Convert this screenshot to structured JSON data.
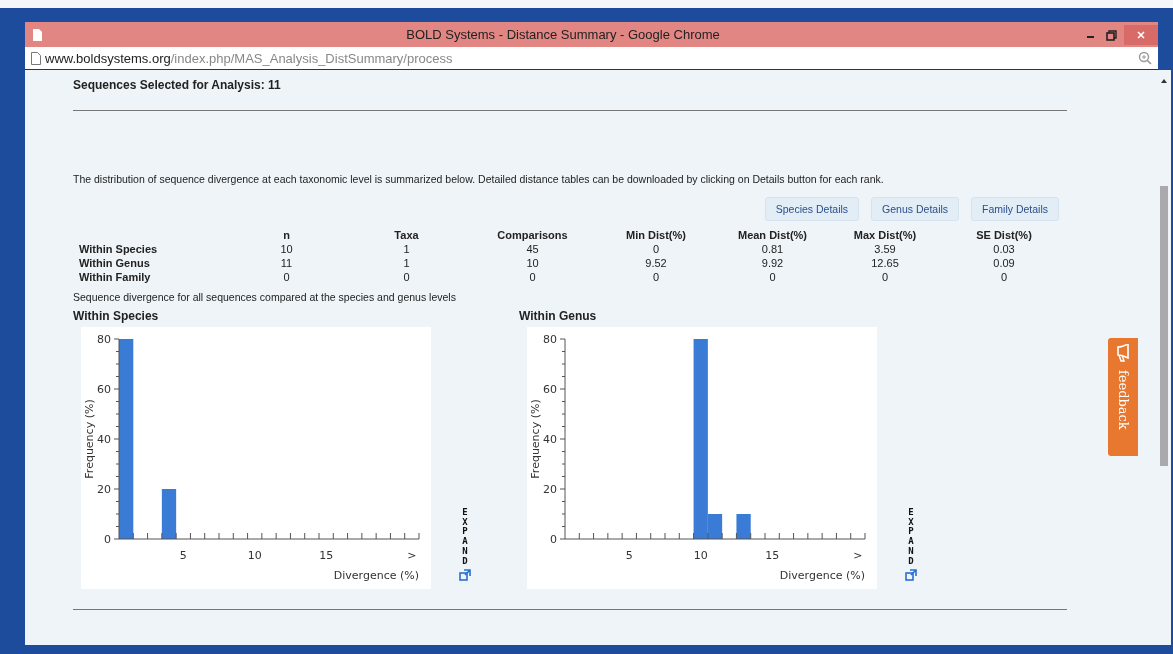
{
  "window": {
    "title": "BOLD Systems - Distance Summary - Google Chrome"
  },
  "address_bar": {
    "host": "www.boldsystems.org",
    "path": "/index.php/MAS_Analysis_DistSummary/process"
  },
  "heading": "Sequences Selected for Analysis: 11",
  "description": "The distribution of sequence divergence at each taxonomic level is summarized below. Detailed distance tables can be downloaded by clicking on Details button for each rank.",
  "buttons": [
    "Species Details",
    "Genus Details",
    "Family Details"
  ],
  "table": {
    "columns": [
      "",
      "n",
      "Taxa",
      "Comparisons",
      "Min Dist(%)",
      "Mean Dist(%)",
      "Max Dist(%)",
      "SE Dist(%)"
    ],
    "rows": [
      [
        "Within Species",
        "10",
        "1",
        "45",
        "0",
        "0.81",
        "3.59",
        "0.03"
      ],
      [
        "Within Genus",
        "11",
        "1",
        "10",
        "9.52",
        "9.92",
        "12.65",
        "0.09"
      ],
      [
        "Within Family",
        "0",
        "0",
        "0",
        "0",
        "0",
        "0",
        "0"
      ]
    ]
  },
  "charts_caption": "Sequence divergence for all sequences compared at the species and genus levels",
  "charts": [
    {
      "expand_label": "EXPAND",
      "chart_data": {
        "type": "bar",
        "title": "Within Species",
        "xlabel": "Divergence (%)",
        "ylabel": "Frequency (%)",
        "x": [
          1,
          2,
          3,
          4,
          5,
          6,
          7,
          8,
          9,
          10,
          11,
          12,
          13,
          14,
          15,
          16,
          17,
          18,
          19,
          20,
          21
        ],
        "series": [
          {
            "color": "#3a7bd5",
            "values": [
              80,
              0,
              0,
              20,
              0,
              0,
              0,
              0,
              0,
              0,
              0,
              0,
              0,
              0,
              0,
              0,
              0,
              0,
              0,
              0,
              0
            ]
          }
        ],
        "xlim": [
          0.5,
          21.5
        ],
        "ylim": [
          0,
          80
        ],
        "yticks": [
          0,
          20,
          40,
          60,
          80
        ],
        "xticks": [
          5,
          10,
          15,
          {
            "value": 21,
            "label": ">"
          }
        ]
      }
    },
    {
      "expand_label": "EXPAND",
      "chart_data": {
        "type": "bar",
        "title": "Within Genus",
        "xlabel": "Divergence (%)",
        "ylabel": "Frequency (%)",
        "x": [
          1,
          2,
          3,
          4,
          5,
          6,
          7,
          8,
          9,
          10,
          11,
          12,
          13,
          14,
          15,
          16,
          17,
          18,
          19,
          20,
          21
        ],
        "series": [
          {
            "color": "#3a7bd5",
            "values": [
              0,
              0,
              0,
              0,
              0,
              0,
              0,
              0,
              0,
              80,
              10,
              0,
              10,
              0,
              0,
              0,
              0,
              0,
              0,
              0,
              0
            ]
          }
        ],
        "xlim": [
          0.5,
          21.5
        ],
        "ylim": [
          0,
          80
        ],
        "yticks": [
          0,
          20,
          40,
          60,
          80
        ],
        "xticks": [
          5,
          10,
          15,
          {
            "value": 21,
            "label": ">"
          }
        ]
      }
    }
  ],
  "feedback_tab": {
    "label": "feedback"
  }
}
